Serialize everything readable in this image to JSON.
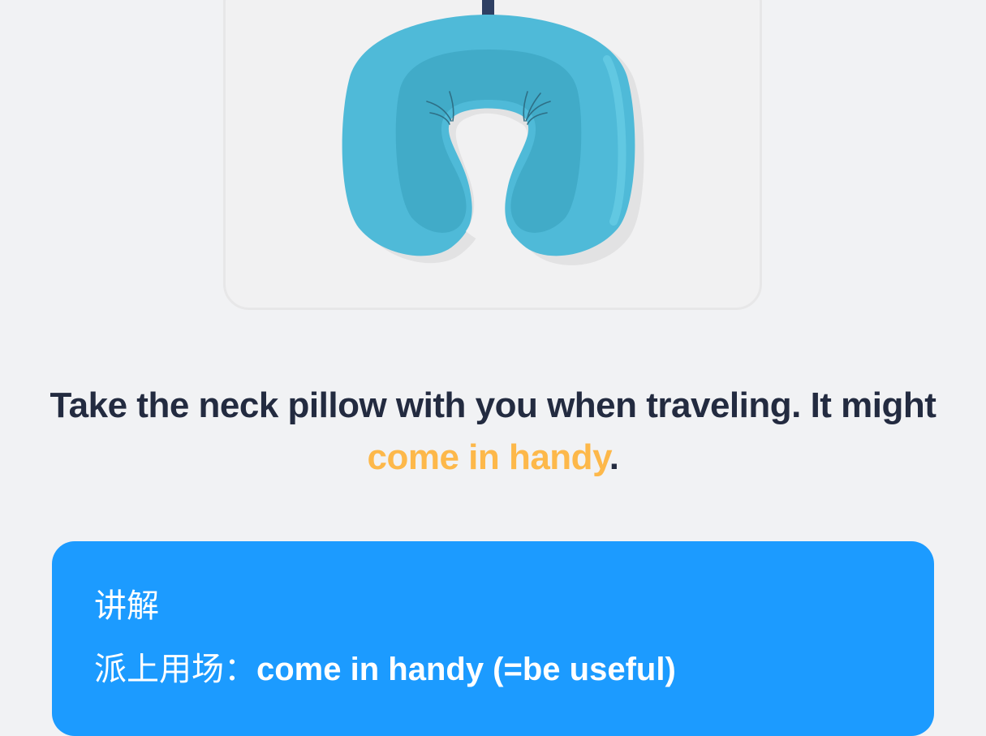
{
  "illustration": {
    "subject": "neck-pillow-icon",
    "colors": {
      "pillow_outer": "#4fbad8",
      "pillow_inner": "#41abc8",
      "strap": "#2e3f63",
      "shadow": "#e2e2e3"
    }
  },
  "sentence": {
    "before": "Take the neck pillow with you when traveling. It might ",
    "highlight": "come in handy",
    "after": "."
  },
  "explanation": {
    "title": "讲解",
    "label": "派上用场：",
    "phrase": "come in handy (=be useful)"
  },
  "colors": {
    "background": "#f1f2f4",
    "accent_highlight": "#fdb84a",
    "card_blue": "#1c9bff",
    "text_dark": "#232b40"
  }
}
